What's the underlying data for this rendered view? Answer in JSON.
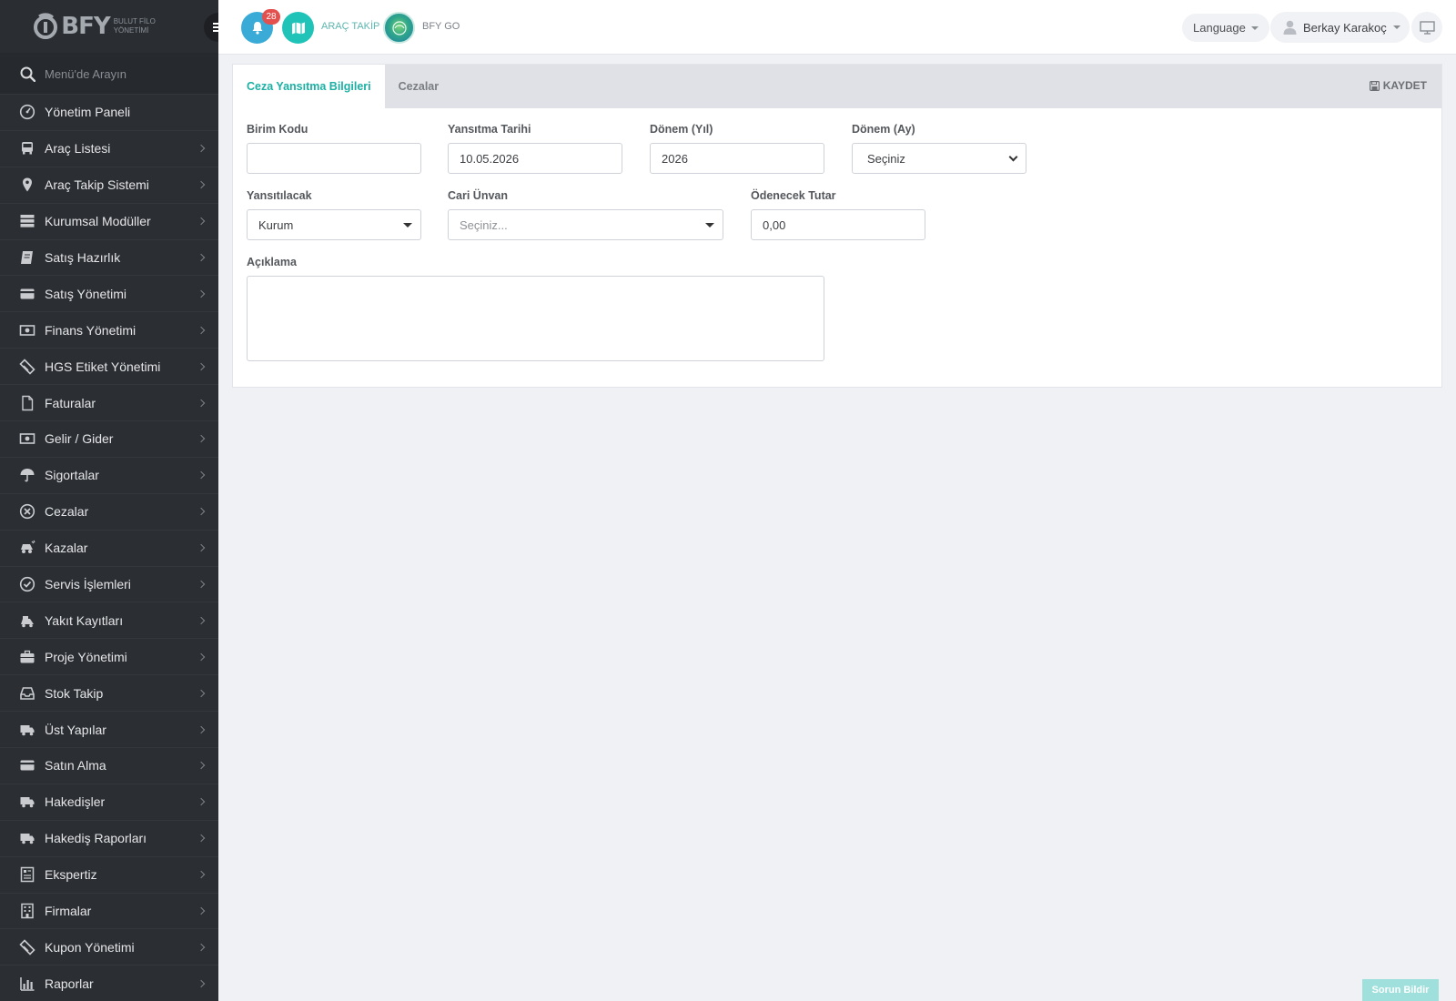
{
  "brand": {
    "logo_text": "BFY",
    "logo_sub": "BULUT FİLO YÖNETİMİ"
  },
  "sidebar": {
    "search_placeholder": "Menü'de Arayın",
    "items": [
      {
        "label": "Yönetim Paneli",
        "icon": "dashboard-icon",
        "has_children": false
      },
      {
        "label": "Araç Listesi",
        "icon": "bus-icon",
        "has_children": true
      },
      {
        "label": "Araç Takip Sistemi",
        "icon": "map-pin-icon",
        "has_children": true
      },
      {
        "label": "Kurumsal Modüller",
        "icon": "server-icon",
        "has_children": true
      },
      {
        "label": "Satış Hazırlık",
        "icon": "book-icon",
        "has_children": true
      },
      {
        "label": "Satış Yönetimi",
        "icon": "credit-card-icon",
        "has_children": true
      },
      {
        "label": "Finans Yönetimi",
        "icon": "money-icon",
        "has_children": true
      },
      {
        "label": "HGS Etiket Yönetimi",
        "icon": "ticket-icon",
        "has_children": true
      },
      {
        "label": "Faturalar",
        "icon": "file-icon",
        "has_children": true
      },
      {
        "label": "Gelir / Gider",
        "icon": "money-icon",
        "has_children": true
      },
      {
        "label": "Sigortalar",
        "icon": "umbrella-icon",
        "has_children": true
      },
      {
        "label": "Cezalar",
        "icon": "times-circle-icon",
        "has_children": true
      },
      {
        "label": "Kazalar",
        "icon": "car-crash-icon",
        "has_children": true
      },
      {
        "label": "Servis İşlemleri",
        "icon": "check-circle-icon",
        "has_children": true
      },
      {
        "label": "Yakıt Kayıtları",
        "icon": "fuel-icon",
        "has_children": true
      },
      {
        "label": "Proje Yönetimi",
        "icon": "briefcase-icon",
        "has_children": true
      },
      {
        "label": "Stok Takip",
        "icon": "inbox-icon",
        "has_children": true
      },
      {
        "label": "Üst Yapılar",
        "icon": "truck-icon",
        "has_children": true
      },
      {
        "label": "Satın Alma",
        "icon": "credit-card-icon",
        "has_children": true
      },
      {
        "label": "Hakedişler",
        "icon": "truck-icon",
        "has_children": true
      },
      {
        "label": "Hakediş Raporları",
        "icon": "truck-icon",
        "has_children": true
      },
      {
        "label": "Ekspertiz",
        "icon": "report-icon",
        "has_children": true
      },
      {
        "label": "Firmalar",
        "icon": "building-icon",
        "has_children": true
      },
      {
        "label": "Kupon Yönetimi",
        "icon": "ticket-icon",
        "has_children": true
      },
      {
        "label": "Raporlar",
        "icon": "bar-chart-icon",
        "has_children": true
      }
    ]
  },
  "header": {
    "notification_count": "28",
    "arac_takip_label": "ARAÇ TAKİP",
    "bfy_go_label": "BFY GO",
    "language_label": "Language",
    "user_name": "Berkay Karakoç"
  },
  "tabs": [
    {
      "label": "Ceza Yansıtma Bilgileri",
      "active": true
    },
    {
      "label": "Cezalar",
      "active": false
    }
  ],
  "save_label": "KAYDET",
  "form": {
    "birim_kodu": {
      "label": "Birim Kodu",
      "value": ""
    },
    "yansitma_tarihi": {
      "label": "Yansıtma Tarihi",
      "value": "10.05.2026"
    },
    "donem_yil": {
      "label": "Dönem (Yıl)",
      "value": "2026"
    },
    "donem_ay": {
      "label": "Dönem (Ay)",
      "value": "Seçiniz"
    },
    "yansitilacak": {
      "label": "Yansıtılacak",
      "value": "Kurum"
    },
    "cari_unvan": {
      "label": "Cari Ünvan",
      "placeholder": "Seçiniz..."
    },
    "odenecek_tutar": {
      "label": "Ödenecek Tutar",
      "value": "0,00"
    },
    "aciklama": {
      "label": "Açıklama",
      "value": ""
    }
  },
  "report_button": "Sorun Bildir",
  "colors": {
    "accent": "#1bb0a3",
    "sidebar_bg": "#2b2e33",
    "bell_bg": "#3aaad6",
    "map_bg": "#1fc3b8",
    "badge": "#e3504d"
  }
}
